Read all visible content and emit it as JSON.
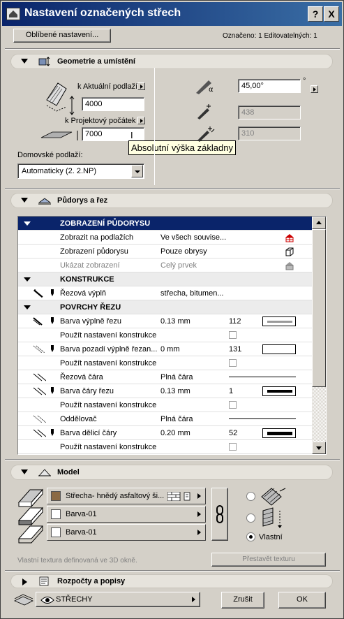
{
  "window": {
    "title": "Nastavení označených střech",
    "help_label": "?",
    "close_label": "X"
  },
  "top": {
    "favorites_label": "Oblíbené nastavení...",
    "selection_info": "Označeno: 1 Editovatelných: 1"
  },
  "geometry": {
    "section_title": "Geometrie a umístění",
    "story_ref_label": "k Aktuální podlaží",
    "height_value": "4000",
    "origin_ref_label": "k Projektový počátek",
    "elevation_value": "7000",
    "tooltip": "Absolutní výška základny",
    "home_story_label": "Domovské podlaží:",
    "home_story_value": "Automaticky (2. 2.NP)",
    "angle_value": "45,00°",
    "angle_unit": "°",
    "thickness_value": "438",
    "offset_value": "310"
  },
  "plan": {
    "section_title": "Půdorys a řez",
    "rows": [
      {
        "type": "head",
        "name": "ZOBRAZENÍ PŮDORYSU"
      },
      {
        "type": "item",
        "name": "Zobrazit na podlažích",
        "value": "Ve všech souvise..."
      },
      {
        "type": "item",
        "name": "Zobrazení půdorysu",
        "value": "Pouze obrysy"
      },
      {
        "type": "dim",
        "name": "Ukázat zobrazení",
        "value": "Celý prvek"
      },
      {
        "type": "group",
        "name": "KONSTRUKCE"
      },
      {
        "type": "item",
        "name": "Řezová výplň",
        "value": "střecha, bitumen..."
      },
      {
        "type": "group",
        "name": "POVRCHY ŘEZU"
      },
      {
        "type": "item",
        "name": "Barva výplně řezu",
        "value": "0.13 mm",
        "num": "112"
      },
      {
        "type": "check",
        "name": "Použít nastavení konstrukce"
      },
      {
        "type": "item",
        "name": "Barva pozadí výplně řezan...",
        "value": "0 mm",
        "num": "131"
      },
      {
        "type": "check",
        "name": "Použít nastavení konstrukce"
      },
      {
        "type": "item",
        "name": "Řezová čára",
        "value": "Plná čára"
      },
      {
        "type": "item",
        "name": "Barva čáry řezu",
        "value": "0.13 mm",
        "num": "1"
      },
      {
        "type": "check",
        "name": "Použít nastavení konstrukce"
      },
      {
        "type": "item",
        "name": "Oddělovač",
        "value": "Plná čára"
      },
      {
        "type": "item",
        "name": "Barva dělicí čáry",
        "value": "0.20 mm",
        "num": "52"
      },
      {
        "type": "check",
        "name": "Použít nastavení konstrukce"
      }
    ]
  },
  "model": {
    "section_title": "Model",
    "materials": [
      {
        "label": "Střecha- hnědý asfaltový ši...",
        "color": "#8b6a44"
      },
      {
        "label": "Barva-01",
        "color": "#ffffff"
      },
      {
        "label": "Barva-01",
        "color": "#ffffff"
      }
    ],
    "custom_label": "Vlastní",
    "texture_note": "Vlastní textura definovaná ve 3D okně.",
    "rebuild_texture_label": "Přestavět texturu"
  },
  "listing": {
    "section_title": "Rozpočty a popisy"
  },
  "bottom": {
    "layer_value": "STŘECHY",
    "cancel_label": "Zrušit",
    "ok_label": "OK"
  },
  "colors": {
    "title_bar": "#0a246a",
    "dialog_face": "#d4d0c8",
    "table_header": "#0a246a"
  }
}
